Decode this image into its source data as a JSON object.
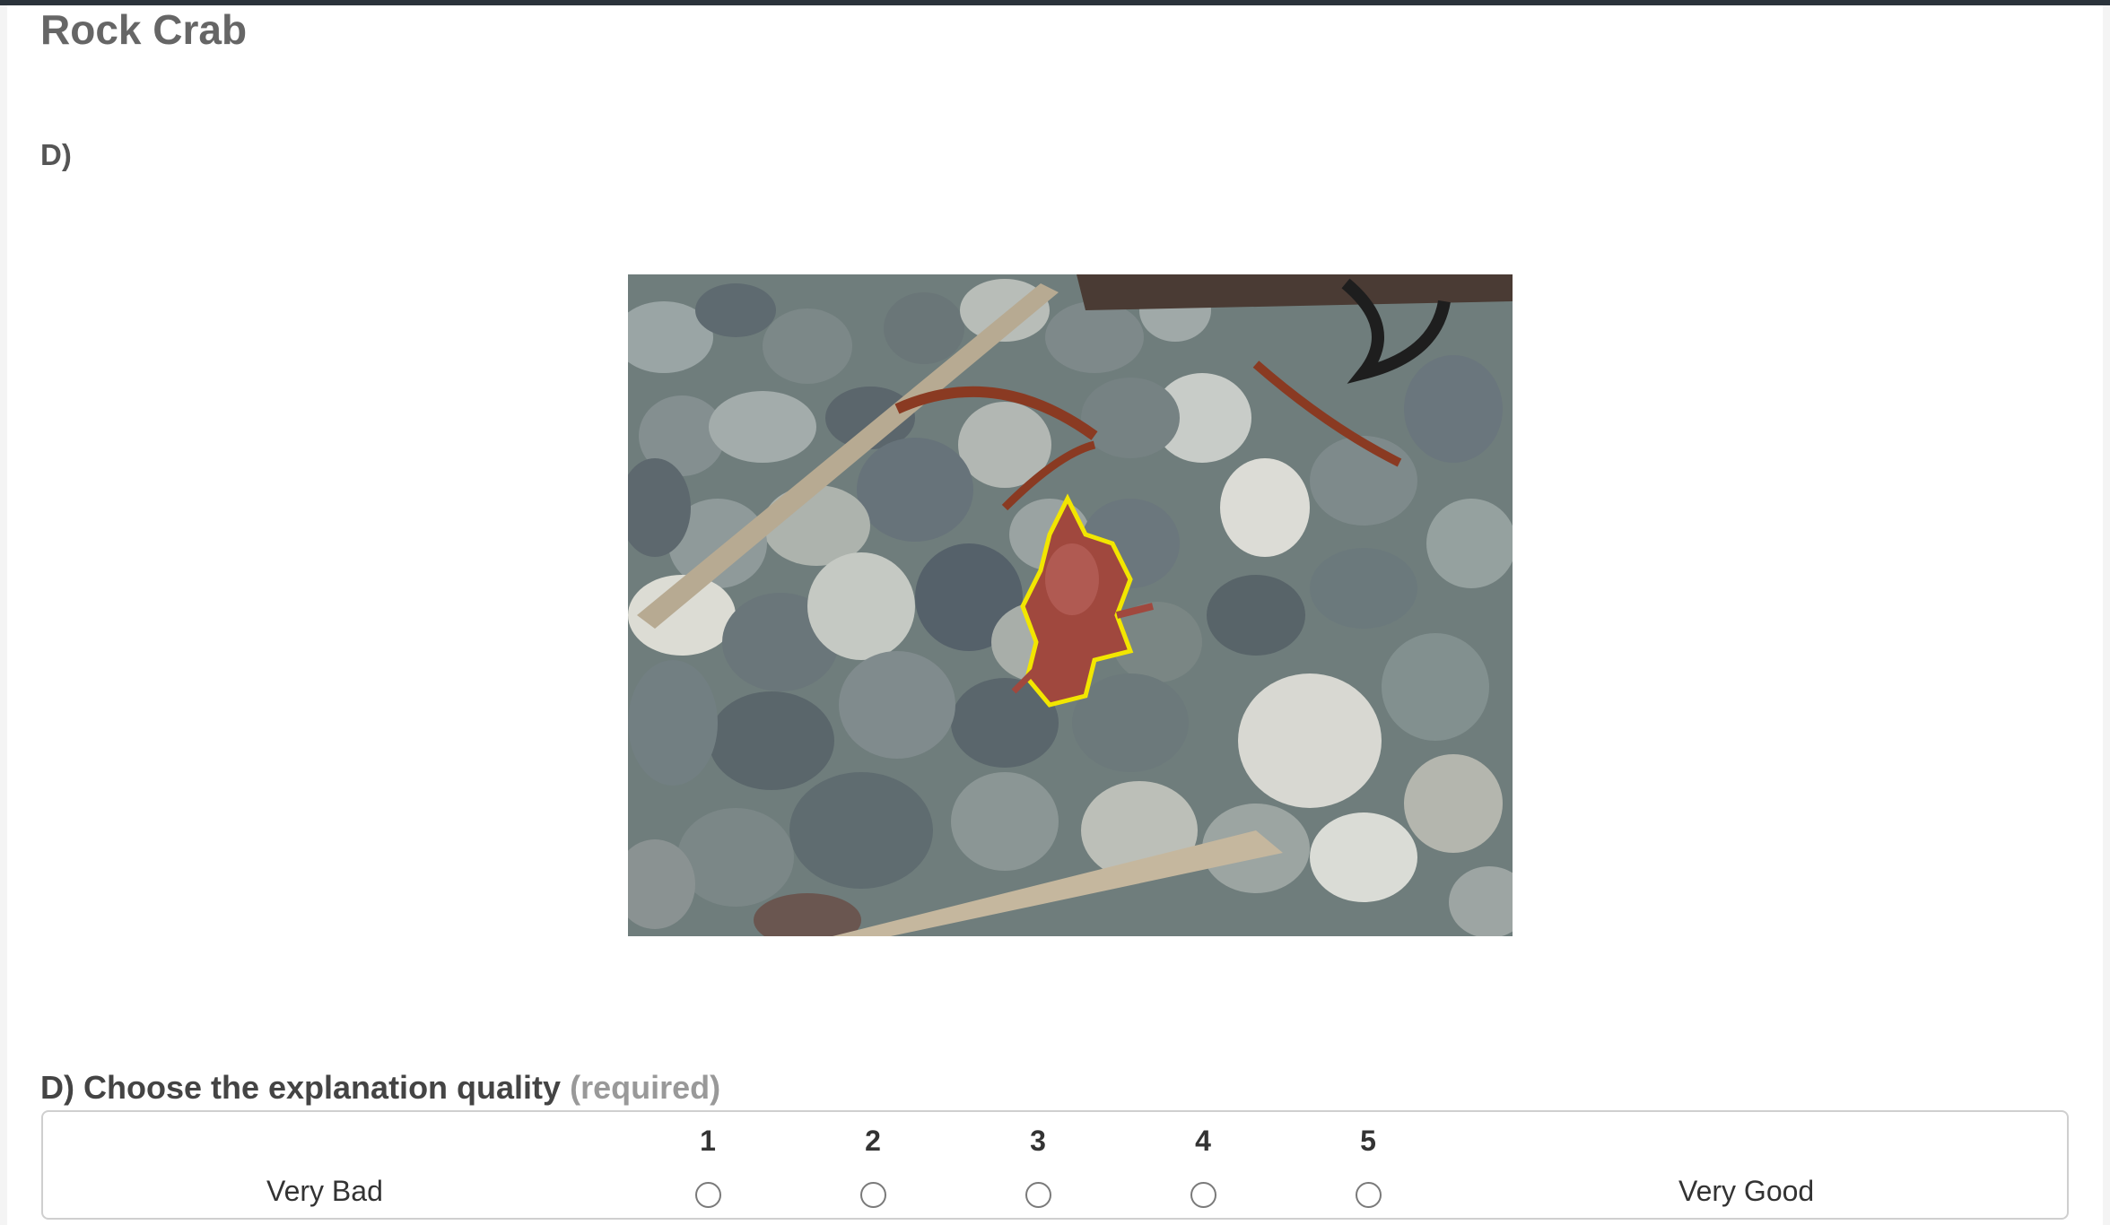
{
  "page": {
    "title": "Rock Crab",
    "question_label": "D)"
  },
  "rating": {
    "question": "D) Choose the explanation quality",
    "required": "(required)",
    "low_label": "Very Bad",
    "high_label": "Very Good",
    "options": [
      "1",
      "2",
      "3",
      "4",
      "5"
    ],
    "selected": null
  },
  "colors": {
    "top_bar": "#2b333b",
    "title": "#666666",
    "highlight_outline": "#f2e600"
  }
}
